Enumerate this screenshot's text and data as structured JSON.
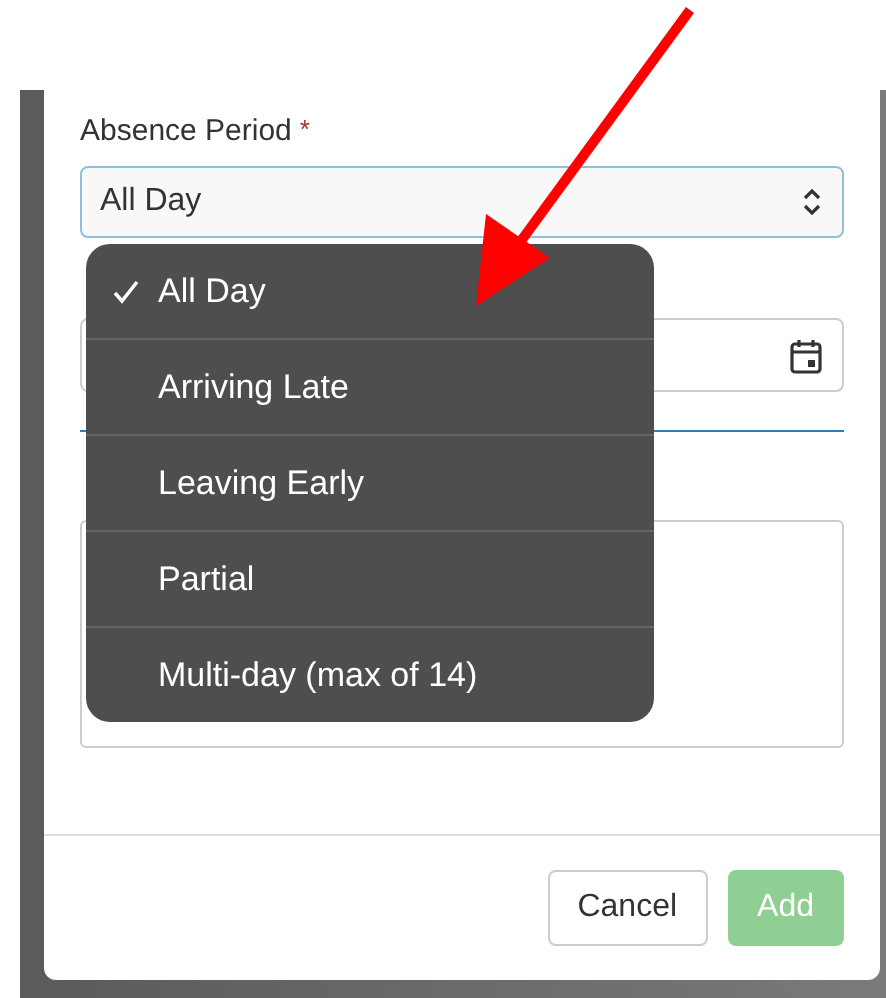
{
  "form": {
    "absence_label": "Absence Period",
    "required_mark": "*",
    "absence_value": "All Day"
  },
  "dropdown": {
    "options": [
      {
        "label": "All Day",
        "selected": true
      },
      {
        "label": "Arriving Late",
        "selected": false
      },
      {
        "label": "Leaving Early",
        "selected": false
      },
      {
        "label": "Partial",
        "selected": false
      },
      {
        "label": "Multi-day (max of 14)",
        "selected": false
      }
    ]
  },
  "buttons": [
    {
      "label": "Cancel",
      "kind": "secondary",
      "disabled": false
    },
    {
      "label": "Add",
      "kind": "primary",
      "disabled": true
    }
  ]
}
